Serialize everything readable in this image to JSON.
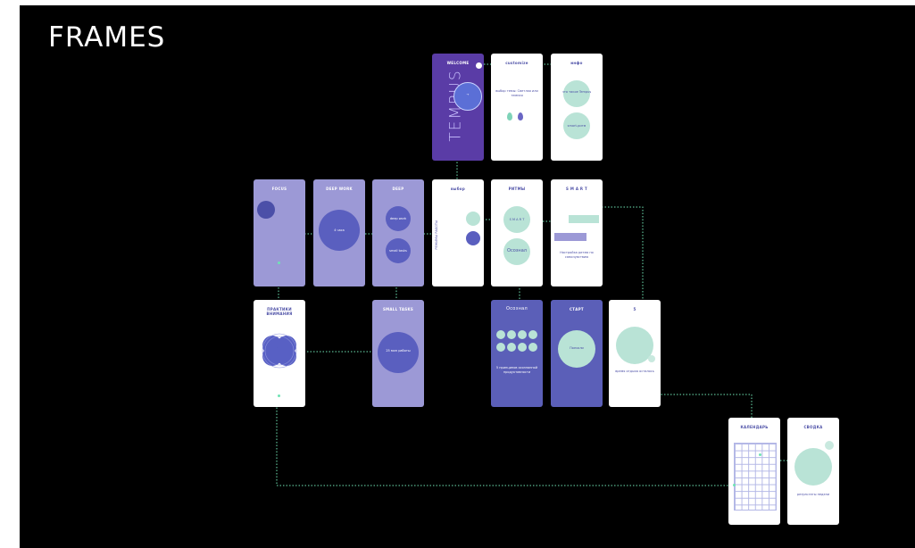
{
  "page": {
    "title": "FRAMES"
  },
  "colors": {
    "background": "#000000",
    "white_screen": "#ffffff",
    "lavender_screen": "#9c99d6",
    "blue_screen": "#5b5fb8",
    "purple_screen": "#5a3ca6",
    "mint": "#b9e3d6",
    "connector": "#6fe3b4"
  },
  "screens": {
    "welcome": {
      "title": "WELCOME",
      "brand": "TEMPUS",
      "circle_text": "→"
    },
    "customize": {
      "title": "customize",
      "body": "выбор темы: Светлая или темная"
    },
    "info": {
      "title": "инфо",
      "circle1": "что такое Tempus",
      "circle2": "smart-ритм"
    },
    "focus": {
      "title": "FOCUS"
    },
    "deep_work": {
      "title": "DEEP WORK",
      "circle": "4 часа"
    },
    "deep": {
      "title": "DEEP",
      "circle1": "deep work",
      "circle2": "small tasks"
    },
    "choose": {
      "title": "выбор",
      "side": "РЕЖИМЫ РАБОТЫ"
    },
    "rhythm": {
      "title": "РИТМЫ",
      "circle1": "S M A R T",
      "circle2": "Осознал"
    },
    "smart": {
      "title": "S M A R T",
      "body": "Настройка ритма по самочувствию"
    },
    "meditation": {
      "title": "ПРАКТИКИ ВНИМАНИЯ",
      "subtitle": ""
    },
    "small_tasks": {
      "title": "SMALL TASKS",
      "circle": "25 мин работы"
    },
    "aware": {
      "title": "Осознал",
      "body": "5 принципов осознанной продуктивности"
    },
    "start": {
      "title": "СТАРТ",
      "circle": "Поехали"
    },
    "timer": {
      "title": "5",
      "body": "время отдыха осталось"
    },
    "calendar": {
      "title": "КАЛЕНДАРЬ"
    },
    "stats": {
      "title": "СВОДКА",
      "body": "результаты недели"
    }
  }
}
